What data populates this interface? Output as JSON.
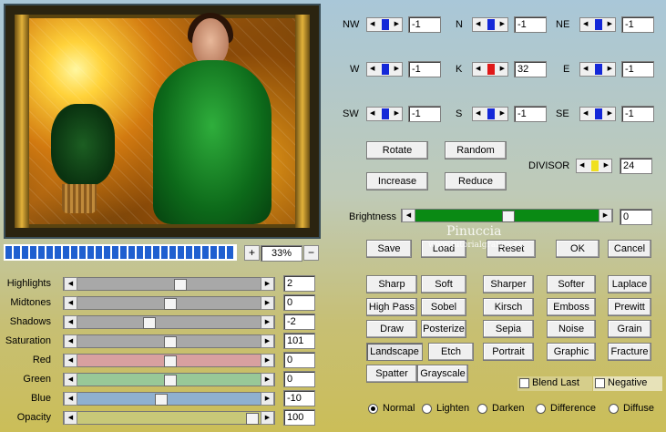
{
  "zoom": {
    "plus": "+",
    "minus": "−",
    "value": "33%"
  },
  "progress": {
    "fraction": 1.0
  },
  "sliders": [
    {
      "label": "Highlights",
      "value": "2",
      "pos": 0.56,
      "color": "#a8a8a8"
    },
    {
      "label": "Midtones",
      "value": "0",
      "pos": 0.5,
      "color": "#a8a8a8"
    },
    {
      "label": "Shadows",
      "value": "-2",
      "pos": 0.38,
      "color": "#a8a8a8"
    },
    {
      "label": "Saturation",
      "value": "101",
      "pos": 0.5,
      "color": "#a8a8a8"
    },
    {
      "label": "Red",
      "value": "0",
      "pos": 0.5,
      "color": "#d8a0a0"
    },
    {
      "label": "Green",
      "value": "0",
      "pos": 0.5,
      "color": "#98c898"
    },
    {
      "label": "Blue",
      "value": "-10",
      "pos": 0.45,
      "color": "#8fb0d0"
    },
    {
      "label": "Opacity",
      "value": "100",
      "pos": 0.98,
      "color": "#c8c878"
    }
  ],
  "matrix": [
    {
      "label": "NW",
      "value": "-1",
      "color": "#1428d8"
    },
    {
      "label": "N",
      "value": "-1",
      "color": "#1428d8"
    },
    {
      "label": "NE",
      "value": "-1",
      "color": "#1428d8"
    },
    {
      "label": "W",
      "value": "-1",
      "color": "#1428d8"
    },
    {
      "label": "K",
      "value": "32",
      "color": "#e01818"
    },
    {
      "label": "E",
      "value": "-1",
      "color": "#1428d8"
    },
    {
      "label": "SW",
      "value": "-1",
      "color": "#1428d8"
    },
    {
      "label": "S",
      "value": "-1",
      "color": "#1428d8"
    },
    {
      "label": "SE",
      "value": "-1",
      "color": "#1428d8"
    }
  ],
  "matrix_buttons": {
    "rotate": "Rotate",
    "random": "Random",
    "increase": "Increase",
    "reduce": "Reduce"
  },
  "divisor": {
    "label": "DIVISOR",
    "value": "24",
    "color": "#f0e020"
  },
  "brightness": {
    "label": "Brightness",
    "value": "0",
    "pos": 0.5,
    "color": "#0a8a14"
  },
  "actions": {
    "save": "Save",
    "load": "Load",
    "reset": "Reset",
    "ok": "OK",
    "cancel": "Cancel"
  },
  "presets": [
    [
      "Sharp",
      "Soft",
      "Sharper",
      "Softer",
      "Laplace"
    ],
    [
      "High Pass",
      "Sobel",
      "Kirsch",
      "Emboss",
      "Prewitt"
    ],
    [
      "Draw",
      "Posterize",
      "Sepia",
      "Noise",
      "Grain"
    ],
    [
      "Landscape",
      "Etch",
      "Portrait",
      "Graphic",
      "Fracture"
    ],
    [
      "Spatter",
      "Grayscale"
    ]
  ],
  "checks": {
    "blend_last": "Blend Last",
    "negative": "Negative"
  },
  "modes": {
    "selected": "Normal",
    "items": [
      "Normal",
      "Lighten",
      "Darken",
      "Difference",
      "Diffuse"
    ]
  },
  "watermark": {
    "line1": "Pinuccia",
    "line2": "www.tutorialgrafica.eu"
  }
}
